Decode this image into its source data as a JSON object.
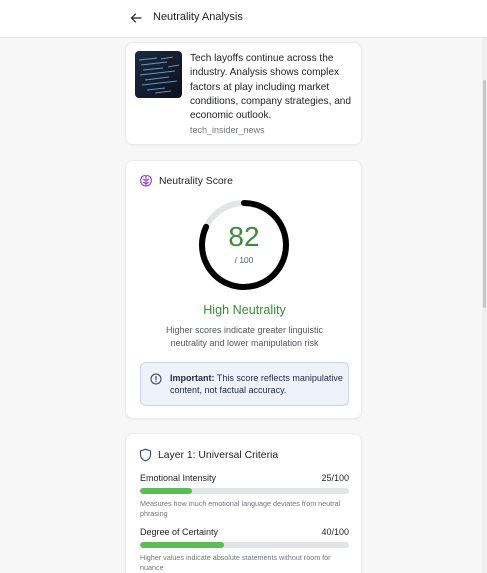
{
  "header": {
    "title": "Neutrality Analysis",
    "back_icon": "arrow-left-icon"
  },
  "article": {
    "text": "Tech layoffs continue across the industry. Analysis shows complex factors at play including market conditions, company strategies, and economic outlook.",
    "source": "tech_insider_news"
  },
  "score": {
    "heading": "Neutrality Score",
    "icon": "brain-icon",
    "value": "82",
    "value_num": 82,
    "max": 100,
    "total": "/ 100",
    "level": "High Neutrality",
    "description": "Higher scores indicate greater linguistic neutrality and lower manipulation risk",
    "notice_strong": "Important:",
    "notice_text": " This score reflects manipulative content, not factual accuracy.",
    "accent_color": "#3f8a3c",
    "ring_color": "#000000",
    "track_color": "#e3e4e6"
  },
  "layer1": {
    "heading": "Layer 1: Universal Criteria",
    "icon": "shield-icon",
    "criteria": [
      {
        "name": "Emotional Intensity",
        "score": "25/100",
        "fraction": 0.25,
        "description": "Measures how much emotional language deviates from neutral phrasing"
      },
      {
        "name": "Degree of Certainty",
        "score": "40/100",
        "fraction": 0.4,
        "description": "Higher values indicate absolute statements without room for nuance"
      }
    ],
    "bar_color": "#5cbc58"
  }
}
